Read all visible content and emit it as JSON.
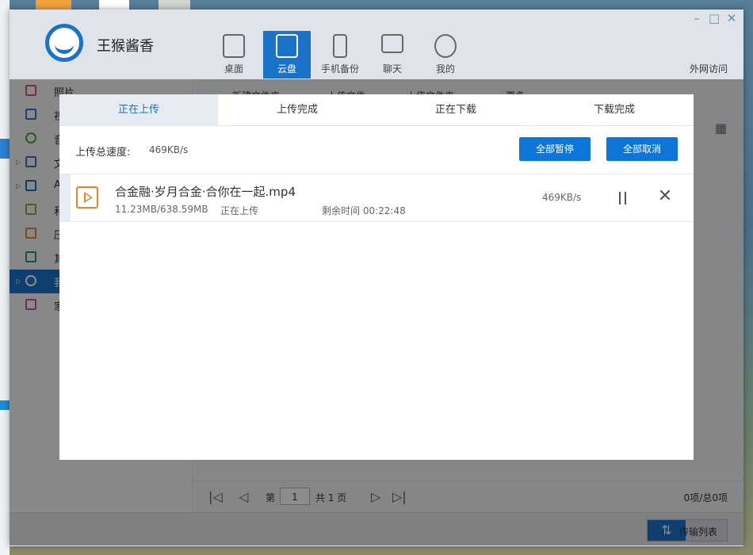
{
  "app": {
    "brand": "王猴酱香",
    "external_access": "外网访问"
  },
  "window_controls": [
    "–",
    "□",
    "✕"
  ],
  "nav_tabs": [
    {
      "label": "桌面",
      "icon": "monitor-icon"
    },
    {
      "label": "云盘",
      "icon": "cloud-drive-icon"
    },
    {
      "label": "手机备份",
      "icon": "phone-icon"
    },
    {
      "label": "聊天",
      "icon": "chat-icon"
    },
    {
      "label": "我的",
      "icon": "user-icon"
    }
  ],
  "sidebar": {
    "items": [
      {
        "label": "照片",
        "icon": "photo-icon"
      },
      {
        "label": "视",
        "icon": "video-icon"
      },
      {
        "label": "音",
        "icon": "music-icon"
      },
      {
        "label": "文",
        "icon": "document-icon"
      },
      {
        "label": "A",
        "icon": "app-icon"
      },
      {
        "label": "和",
        "icon": "book-icon"
      },
      {
        "label": "压",
        "icon": "archive-icon"
      },
      {
        "label": "其",
        "icon": "other-icon"
      },
      {
        "label": "我",
        "icon": "cloud-icon"
      },
      {
        "label": "家",
        "icon": "home-icon"
      }
    ]
  },
  "toolbar": {
    "new_folder": "新建文件夹",
    "upload_file": "上传文件",
    "upload_folder": "上传文件夹",
    "more": "更多"
  },
  "pager": {
    "prefix": "第",
    "page": "1",
    "total": "共 1 页",
    "count": "0项/总0项"
  },
  "statusbar": {
    "transfer_list": "传输列表"
  },
  "dialog": {
    "tabs": [
      "正在上传",
      "上传完成",
      "正在下载",
      "下载完成"
    ],
    "speed_label": "上传总速度:",
    "speed_value": "469KB/s",
    "pause_all": "全部暂停",
    "cancel_all": "全部取消",
    "task": {
      "name": "合金融·岁月合金·合你在一起.mp4",
      "progress": "11.23MB/638.59MB",
      "state": "正在上传",
      "remaining": "剩余时间 00:22:48",
      "rate": "469KB/s"
    }
  },
  "colors": {
    "accent": "#1b73c9",
    "button": "#0e76d8",
    "file_icon": "#e6862a"
  }
}
